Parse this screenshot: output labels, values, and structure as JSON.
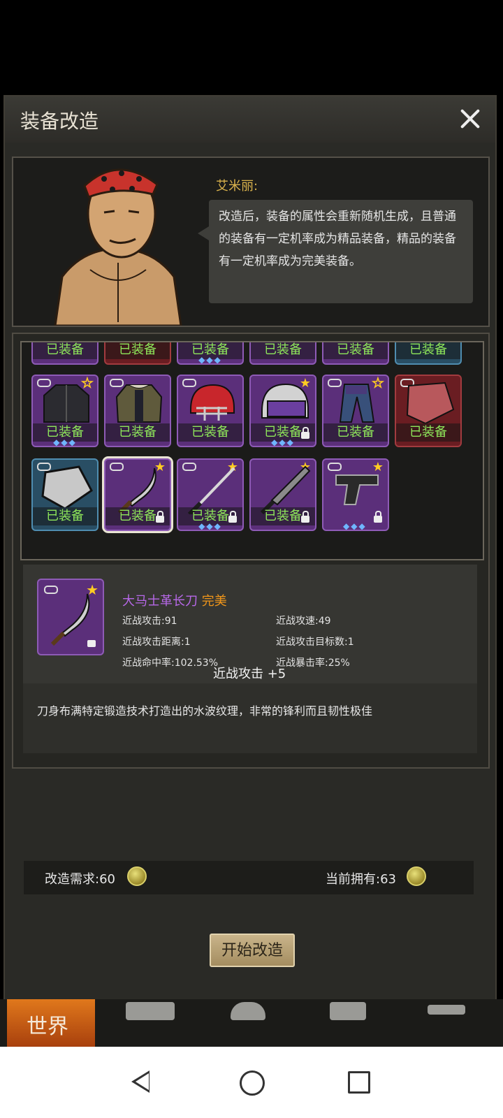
{
  "dialog": {
    "title": "装备改造"
  },
  "npc": {
    "name": "艾米丽:",
    "speech": "改造后，装备的属性会重新随机生成，且普通的装备有一定机率成为精品装备，精品的装备有一定机率成为完美装备。"
  },
  "inventory": {
    "equipped_label": "已装备",
    "rows": [
      [
        {
          "name": "item-top-1",
          "color": "purple",
          "equipped": true
        },
        {
          "name": "item-top-2",
          "color": "red",
          "equipped": true
        },
        {
          "name": "item-top-3",
          "color": "purple",
          "equipped": true,
          "gems": "◆◆◆"
        },
        {
          "name": "item-top-4",
          "color": "purple",
          "equipped": true
        },
        {
          "name": "item-top-5",
          "color": "purple",
          "equipped": true
        },
        {
          "name": "item-top-6",
          "color": "blue",
          "equipped": true
        }
      ],
      [
        {
          "name": "black-jacket",
          "color": "purple",
          "equipped": true,
          "gems": "◆◆◆"
        },
        {
          "name": "parka-coat",
          "color": "purple",
          "equipped": true
        },
        {
          "name": "football-helmet",
          "color": "purple",
          "equipped": true
        },
        {
          "name": "police-helmet",
          "color": "purple",
          "equipped": true,
          "gems": "◆◆◆"
        },
        {
          "name": "armored-pants",
          "color": "purple",
          "equipped": true
        },
        {
          "name": "red-shield",
          "color": "red",
          "equipped": true
        }
      ],
      [
        {
          "name": "metal-shield",
          "color": "blue",
          "equipped": true
        },
        {
          "name": "damascus-sabre",
          "color": "purple",
          "equipped": true,
          "selected": true
        },
        {
          "name": "katana",
          "color": "purple",
          "equipped": true,
          "gems": "◆◆◆"
        },
        {
          "name": "machete",
          "color": "purple",
          "equipped": true
        },
        {
          "name": "pistol",
          "color": "purple",
          "equipped": false,
          "gems": "◆◆◆"
        }
      ]
    ]
  },
  "item": {
    "name": "大马士革长刀",
    "quality": "完美",
    "stats": {
      "melee_attack": "近战攻击:91",
      "melee_speed": "近战攻速:49",
      "melee_range": "近战攻击距离:1",
      "melee_targets": "近战攻击目标数:1",
      "melee_accuracy": "近战命中率:102.53%",
      "melee_crit": "近战暴击率:25%"
    },
    "bonus": "近战攻击 +5",
    "description": "刀身布满特定锻造技术打造出的水波纹理，非常的锋利而且韧性极佳"
  },
  "cost": {
    "required": "改造需求:60",
    "owned": "当前拥有:63"
  },
  "actions": {
    "start": "开始改造"
  },
  "game_nav": {
    "world": "世界"
  },
  "colors": {
    "equipped_text": "#8ee65a",
    "item_name": "#b768e8",
    "quality_perfect": "#f0961a",
    "npc_name": "#d9b24c"
  }
}
